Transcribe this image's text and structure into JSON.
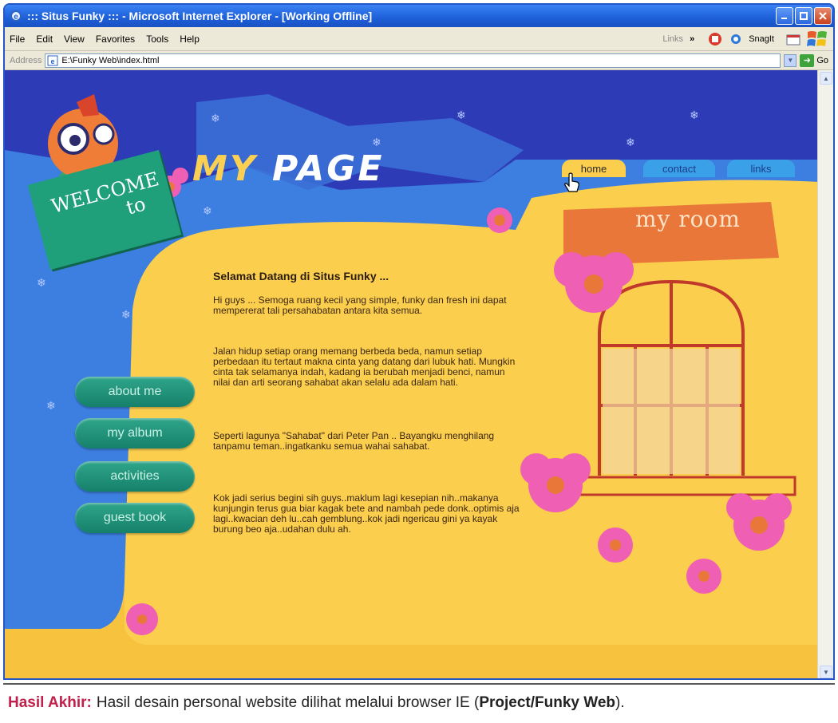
{
  "window": {
    "title": "::: Situs Funky ::: - Microsoft Internet Explorer - [Working Offline]"
  },
  "menu": {
    "items": [
      "File",
      "Edit",
      "View",
      "Favorites",
      "Tools",
      "Help"
    ],
    "links_label": "Links",
    "chevron": "»",
    "snagit_label": "SnagIt"
  },
  "address": {
    "label": "Address",
    "value": "E:\\Funky Web\\index.html",
    "go_label": "Go"
  },
  "site": {
    "logo_text_1": "MY",
    "logo_text_2": "PAGE",
    "welcome_line1": "WELCOME",
    "welcome_line2": "to",
    "tabs": [
      "home",
      "contact",
      "links"
    ],
    "room_title": "my room",
    "nav": [
      "about me",
      "my album",
      "activities",
      "guest book"
    ],
    "heading": "Selamat Datang di Situs Funky ...",
    "paragraphs": [
      "Hi guys ... Semoga ruang kecil yang simple, funky dan fresh ini dapat mempererat tali persahabatan antara kita semua.",
      "Jalan hidup setiap orang memang berbeda beda, namun setiap perbedaan itu tertaut makna cinta yang datang dari lubuk hati. Mungkin cinta tak selamanya indah, kadang ia berubah menjadi benci, namun nilai dan arti seorang sahabat akan selalu ada dalam hati.",
      "Seperti lagunya \"Sahabat\" dari Peter Pan .. Bayangku menghilang tanpamu teman..ingatkanku semua wahai sahabat.",
      "Kok jadi serius begini sih guys..maklum lagi kesepian nih..makanya kunjungin terus gua biar kagak bete and nambah pede donk..optimis aja lagi..kwacian deh lu..cah gemblung..kok jadi ngericau gini ya kayak burung beo aja..udahan dulu ah."
    ]
  },
  "caption": {
    "lead": "Hasil Akhir:",
    "text": "Hasil desain personal website dilihat melalui browser IE (",
    "strong": "Project/Funky Web",
    "tail": ")."
  },
  "colors": {
    "sky": "#2e3bb6",
    "sky_light": "#3c7fe0",
    "yellow": "#fbce4e",
    "teal": "#1f9f7a",
    "pink": "#ef5fb4",
    "orange": "#e9773a",
    "window_frame": "#c1392b"
  }
}
